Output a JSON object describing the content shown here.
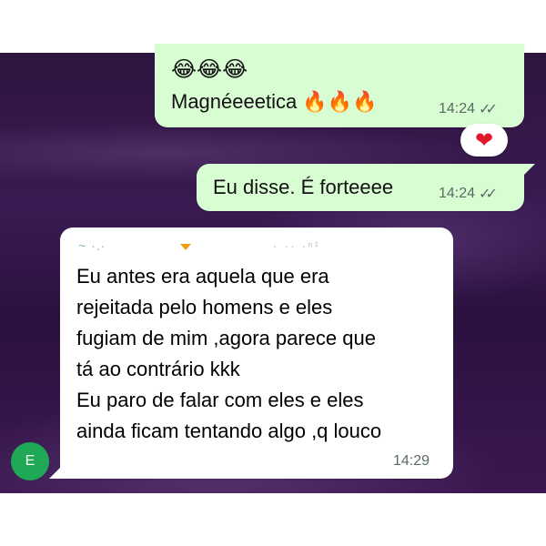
{
  "messages": {
    "out1": {
      "emoji_row": "😂😂😂",
      "text": "Magnéeeetica 🔥🔥🔥",
      "time": "14:24",
      "status": "✓✓"
    },
    "reaction": "❤",
    "out2": {
      "text": "Eu disse. É forteeee",
      "time": "14:24",
      "status": "✓✓"
    },
    "in1": {
      "sender_name": "~ ·.·",
      "sender_phone": "· ·· ·ⁿ¹",
      "lines": [
        "Eu antes era aquela que era",
        "rejeitada pelo homens e eles",
        "fugiam de mim ,agora parece que",
        "tá ao contrário kkk",
        "Eu paro de falar com eles e eles",
        "ainda ficam tentando algo ,q louco"
      ],
      "time": "14:29"
    }
  },
  "avatar": {
    "initial": "E",
    "color": "#1fa855"
  },
  "colors": {
    "outgoing_bubble": "#d9fdd3",
    "incoming_bubble": "#ffffff",
    "reaction_heart": "#e0192b"
  }
}
